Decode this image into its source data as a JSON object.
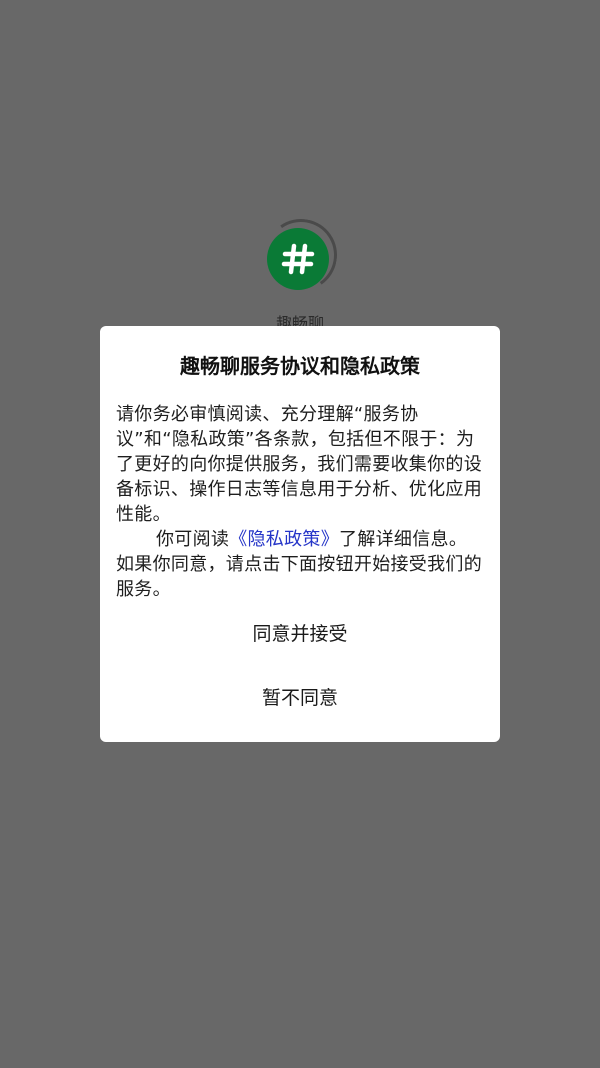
{
  "splash": {
    "app_name": "趣畅聊",
    "logo_icon": "hash-chat-bubble-icon",
    "logo_color": "#0a7a36"
  },
  "dialog": {
    "title": "趣畅聊服务协议和隐私政策",
    "paragraph1": "请你务必审慎阅读、充分理解“服务协议”和“隐私政策”各条款，包括但不限于：为了更好的向你提供服务，我们需要收集你的设备标识、操作日志等信息用于分析、优化应用性能。",
    "paragraph2_before": "你可阅读",
    "policy_link": "《隐私政策》",
    "paragraph2_after": "了解详细信息。如果你同意，请点击下面按钮开始接受我们的服务。",
    "link_color": "#2535c8",
    "accept_label": "同意并接受",
    "decline_label": "暂不同意"
  }
}
